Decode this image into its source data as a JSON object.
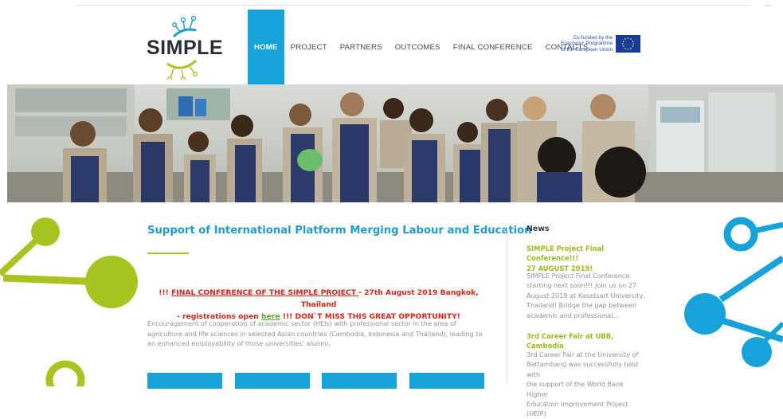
{
  "header": {
    "logo_text": "SIMPLE",
    "nav": [
      "HOME",
      "PROJECT",
      "PARTNERS",
      "OUTCOMES",
      "FINAL CONFERENCE",
      "CONTACTS"
    ],
    "active_nav": "HOME",
    "eu_lines": [
      "Co-funded by the",
      "Erasmus+ Programme",
      "of the European Union"
    ]
  },
  "main": {
    "title": "Support of International Platform Merging Labour and Education",
    "announce": {
      "prefix": "!!! ",
      "link": "FINAL CONFERENCE OF THE SIMPLE PROJECT ",
      "date": " - 27th August 2019 Bangkok, Thailand",
      "line2_pre": "- registrations open ",
      "here": "here",
      "line2_post": " !!! DON`T MISS THIS GREAT OPPORTUNITY!"
    },
    "description": "Encouragement of cooperation of academic sector (HEIs) with professional sector in the area of agriculture and life sciences in selected Asian countries (Cambodia, Indonesia and Thailand), leading to an enhanced employability of those universities' alumni."
  },
  "news": {
    "heading": "News",
    "items": [
      {
        "title_lines": [
          "SIMPLE Project Final Conference!!!",
          "27 AUGUST 2019!"
        ],
        "body_lines": [
          "SIMPLE Project Final Conference",
          "starting next soon!!! Join us on 27",
          "August 2019 at Kasetsart University,",
          "Thailand! Bridge the gap between",
          "academic and professional..."
        ]
      },
      {
        "title_lines": [
          "3rd Career Fair at UBB, Cambodia"
        ],
        "body_lines": [
          "3rd Career Fair at the University of",
          "Battambang was successfully held with",
          "the support of the World Bank Higher",
          "Education Improvement Project (HEIP)"
        ]
      }
    ]
  },
  "colors": {
    "brand_blue": "#17a3d9",
    "brand_green": "#a7c520",
    "alert_red": "#e2201a"
  }
}
